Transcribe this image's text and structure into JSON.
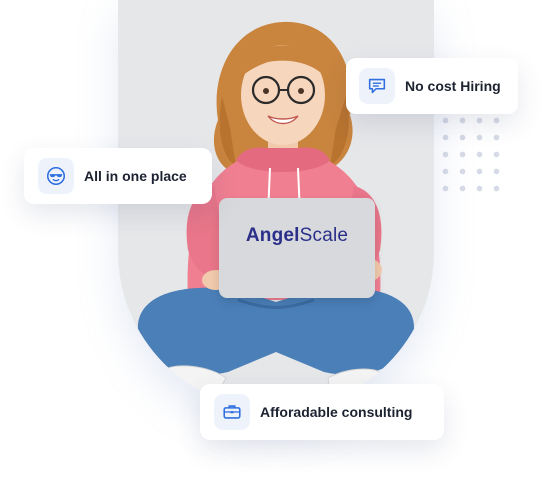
{
  "cards": {
    "no_cost_hiring": {
      "label": "No cost Hiring",
      "icon": "chat-bubble-icon"
    },
    "all_in_one": {
      "label": "All in one place",
      "icon": "cool-face-icon"
    },
    "consulting": {
      "label": "Afforadable consulting",
      "icon": "briefcase-icon"
    }
  },
  "laptop": {
    "brand_bold": "Angel",
    "brand_rest": "Scale"
  },
  "colors": {
    "accent": "#2f6fe0",
    "hoodie": "#f07f92",
    "jeans": "#4a7fb8",
    "hair": "#c9853e",
    "laptop": "#d8d9dc",
    "brand": "#2a2f8a"
  }
}
